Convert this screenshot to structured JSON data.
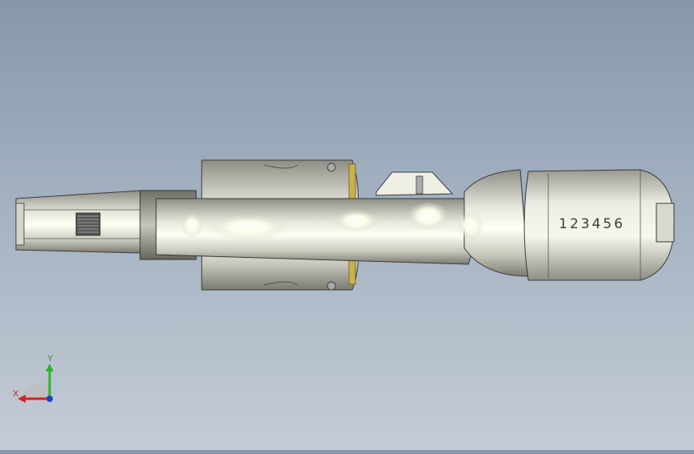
{
  "viewport": {
    "model": "revolver-top-view",
    "serial_number": "123456",
    "background_colors": [
      "#8797ac",
      "#c4ccd6"
    ]
  },
  "triad": {
    "y_label": "Y",
    "x_label": "X",
    "colors": {
      "x": "#d81e1e",
      "y": "#2cb52c",
      "z": "#1f3fd0"
    }
  }
}
